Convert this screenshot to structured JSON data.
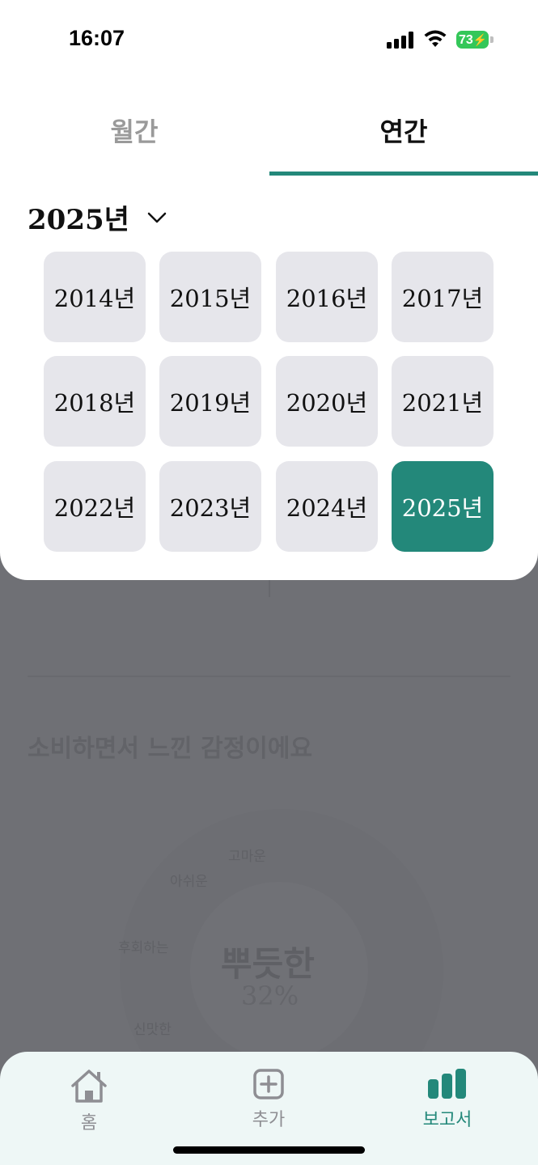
{
  "status_bar": {
    "time": "16:07",
    "battery": "73"
  },
  "tabs": [
    {
      "label": "월간",
      "active": false
    },
    {
      "label": "연간",
      "active": true
    }
  ],
  "year_selector": {
    "label": "2025년"
  },
  "years": [
    "2014년",
    "2015년",
    "2016년",
    "2017년",
    "2018년",
    "2019년",
    "2020년",
    "2021년",
    "2022년",
    "2023년",
    "2024년",
    "2025년"
  ],
  "selected_year": "2025년",
  "background": {
    "section_title": "소비하면서 느낀 감정이에요",
    "donut_center_label": "뿌듯한",
    "donut_center_value": "32%",
    "segment_labels": [
      "고마운",
      "아쉬운",
      "후회하는",
      "신맛한"
    ]
  },
  "bottom_nav": [
    {
      "label": "홈",
      "icon": "home-icon",
      "active": false
    },
    {
      "label": "추가",
      "icon": "plus-square-icon",
      "active": false
    },
    {
      "label": "보고서",
      "icon": "bar-chart-icon",
      "active": true
    }
  ],
  "colors": {
    "accent": "#23887a",
    "tile": "#e6e6eb",
    "battery": "#34c759"
  }
}
